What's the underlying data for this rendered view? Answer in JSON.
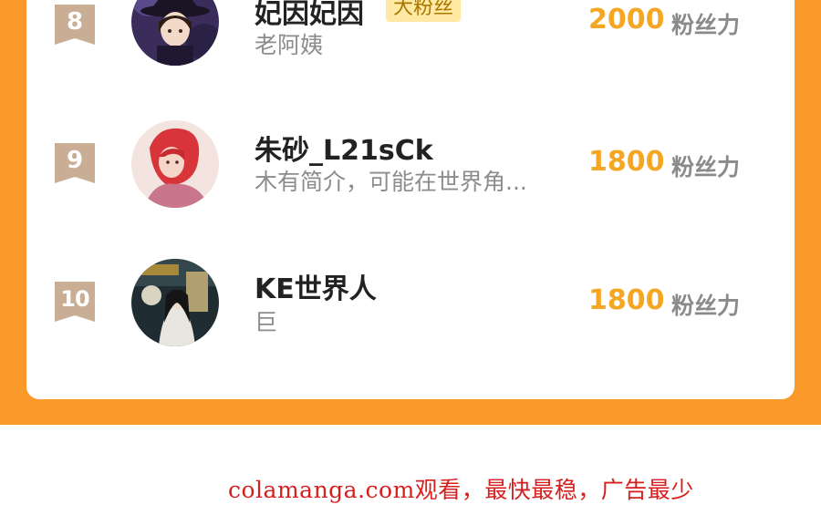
{
  "leaderboard": {
    "score_unit": "粉丝力",
    "entries": [
      {
        "rank": "8",
        "name": "妃因妃因",
        "badge": "大粉丝",
        "subtitle": "老阿姨",
        "score": "2000",
        "avatar_icon": "witch-portrait-avatar"
      },
      {
        "rank": "9",
        "name": "朱砂_L21sCk",
        "badge": "",
        "subtitle": "木有简介，可能在世界角...",
        "score": "1800",
        "avatar_icon": "red-hair-mermaid-avatar"
      },
      {
        "rank": "10",
        "name": "KE世界人",
        "badge": "",
        "subtitle": "巨",
        "score": "1800",
        "avatar_icon": "ancient-costume-character-avatar"
      }
    ]
  },
  "footer": {
    "ad_text": "colamanga.com观看，最快最稳，广告最少"
  },
  "colors": {
    "background_orange": "#fa9a2a",
    "card_white": "#ffffff",
    "score_gold": "#f5a623",
    "rank_badge": "#c9ad95",
    "fan_badge_bg": "#ffe9a3",
    "ad_red": "#d62020"
  }
}
